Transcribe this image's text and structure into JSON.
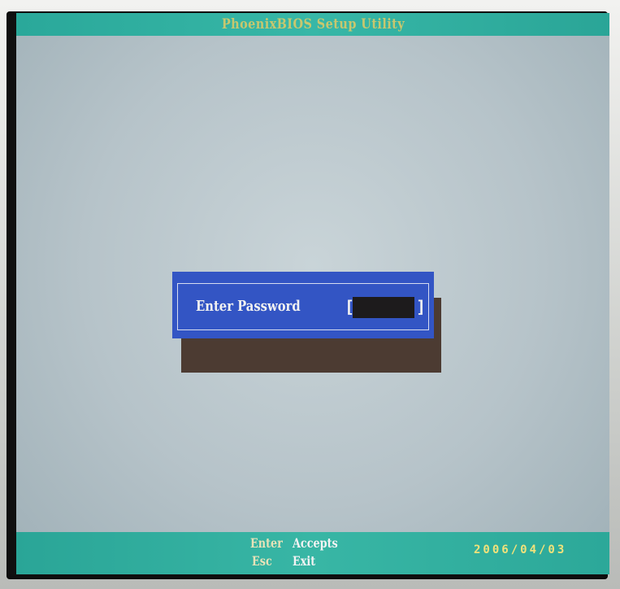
{
  "header": {
    "title": "PhoenixBIOS Setup Utility"
  },
  "dialog": {
    "label": "Enter Password",
    "open_bracket": "[",
    "close_bracket": "]",
    "password_value": ""
  },
  "footer": {
    "keys": [
      {
        "key": "Enter",
        "action": "Accepts"
      },
      {
        "key": "Esc",
        "action": "Exit"
      }
    ]
  },
  "overlay": {
    "date": "2006/04/03"
  },
  "colors": {
    "background": "#b6c3c9",
    "bar": "#2aa597",
    "dialog": "#3355c4",
    "dialog_shadow": "#4c3b32",
    "title_text": "#c7c76e",
    "date_text": "#f2e27a"
  }
}
